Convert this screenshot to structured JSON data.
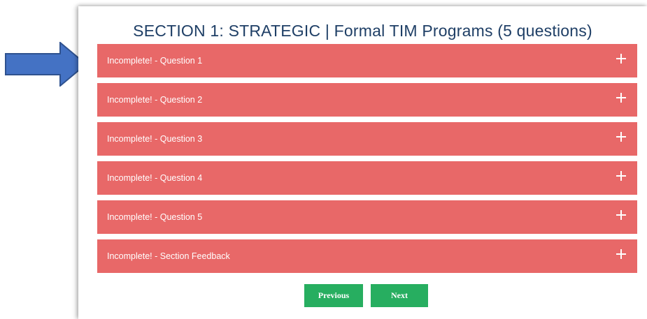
{
  "section": {
    "title": "SECTION 1: STRATEGIC | Formal TIM Programs (5 questions)"
  },
  "accordion": {
    "items": [
      {
        "label": "Incomplete! - Question 1"
      },
      {
        "label": "Incomplete! - Question 2"
      },
      {
        "label": "Incomplete! - Question 3"
      },
      {
        "label": "Incomplete! - Question 4"
      },
      {
        "label": "Incomplete! - Question 5"
      },
      {
        "label": "Incomplete! - Section Feedback"
      }
    ],
    "expand_icon": "plus-icon"
  },
  "nav": {
    "previous_label": "Previous",
    "next_label": "Next"
  },
  "colors": {
    "title": "#1f3f66",
    "incomplete": "#e86868",
    "button": "#27ae60",
    "annotation_arrow": "#4472c4"
  }
}
